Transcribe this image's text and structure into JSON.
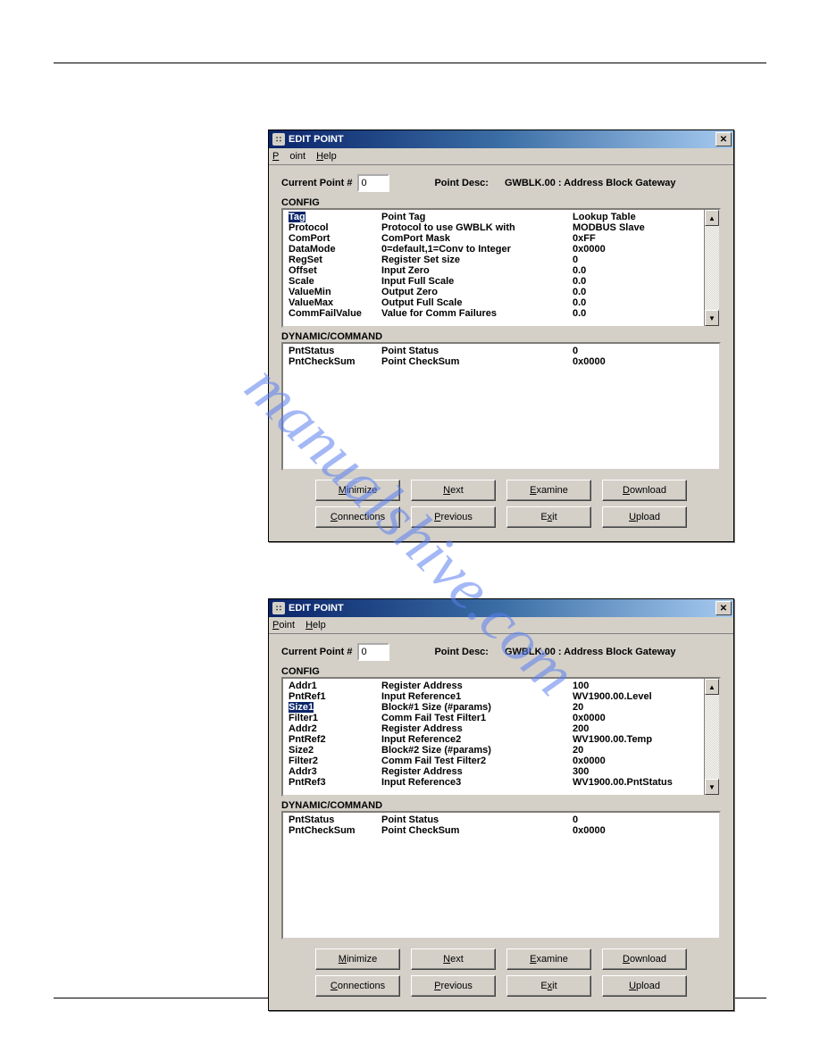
{
  "watermark": "manualshive.com",
  "windows": [
    {
      "title": "EDIT POINT",
      "menu": {
        "point": "Point",
        "help": "Help"
      },
      "current_point_label": "Current Point #",
      "current_point_value": "0",
      "point_desc_label": "Point Desc:",
      "point_desc_value": "GWBLK.00 : Address Block Gateway",
      "config_label": "CONFIG",
      "config_rows": [
        {
          "c1": "Tag",
          "c2": "Point Tag",
          "c3": "Lookup Table",
          "sel": true
        },
        {
          "c1": "Protocol",
          "c2": "Protocol to use GWBLK with",
          "c3": "MODBUS Slave"
        },
        {
          "c1": "ComPort",
          "c2": "ComPort Mask",
          "c3": "0xFF"
        },
        {
          "c1": "DataMode",
          "c2": "0=default,1=Conv to Integer",
          "c3": "0x0000"
        },
        {
          "c1": "RegSet",
          "c2": "Register Set size",
          "c3": "0"
        },
        {
          "c1": "Offset",
          "c2": "Input Zero",
          "c3": "0.0"
        },
        {
          "c1": "Scale",
          "c2": "Input Full Scale",
          "c3": "0.0"
        },
        {
          "c1": "ValueMin",
          "c2": "Output Zero",
          "c3": "0.0"
        },
        {
          "c1": "ValueMax",
          "c2": "Output Full Scale",
          "c3": "0.0"
        },
        {
          "c1": "CommFailValue",
          "c2": "Value for Comm Failures",
          "c3": "0.0"
        }
      ],
      "dynamic_label": "DYNAMIC/COMMAND",
      "dynamic_rows": [
        {
          "c1": "PntStatus",
          "c2": "Point Status",
          "c3": "0"
        },
        {
          "c1": "PntCheckSum",
          "c2": "Point CheckSum",
          "c3": "0x0000"
        }
      ],
      "buttons": {
        "minimize": "Minimize",
        "next": "Next",
        "examine": "Examine",
        "download": "Download",
        "connections": "Connections",
        "previous": "Previous",
        "exit": "Exit",
        "upload": "Upload"
      }
    },
    {
      "title": "EDIT POINT",
      "menu": {
        "point": "Point",
        "help": "Help"
      },
      "current_point_label": "Current Point #",
      "current_point_value": "0",
      "point_desc_label": "Point Desc:",
      "point_desc_value": "GWBLK.00 : Address Block Gateway",
      "config_label": "CONFIG",
      "config_rows": [
        {
          "c1": "Addr1",
          "c2": "Register Address",
          "c3": "100"
        },
        {
          "c1": "PntRef1",
          "c2": "Input Reference1",
          "c3": "WV1900.00.Level"
        },
        {
          "c1": "Size1",
          "c2": "Block#1 Size (#params)",
          "c3": "20",
          "sel": true
        },
        {
          "c1": "Filter1",
          "c2": "Comm Fail Test Filter1",
          "c3": "0x0000"
        },
        {
          "c1": "Addr2",
          "c2": "Register Address",
          "c3": "200"
        },
        {
          "c1": "PntRef2",
          "c2": "Input Reference2",
          "c3": "WV1900.00.Temp"
        },
        {
          "c1": "Size2",
          "c2": "Block#2 Size (#params)",
          "c3": "20"
        },
        {
          "c1": "Filter2",
          "c2": "Comm Fail Test Filter2",
          "c3": "0x0000"
        },
        {
          "c1": "Addr3",
          "c2": "Register Address",
          "c3": "300"
        },
        {
          "c1": "PntRef3",
          "c2": "Input Reference3",
          "c3": "WV1900.00.PntStatus"
        }
      ],
      "dynamic_label": "DYNAMIC/COMMAND",
      "dynamic_rows": [
        {
          "c1": "PntStatus",
          "c2": "Point Status",
          "c3": "0"
        },
        {
          "c1": "PntCheckSum",
          "c2": "Point CheckSum",
          "c3": "0x0000"
        }
      ],
      "buttons": {
        "minimize": "Minimize",
        "next": "Next",
        "examine": "Examine",
        "download": "Download",
        "connections": "Connections",
        "previous": "Previous",
        "exit": "Exit",
        "upload": "Upload"
      }
    }
  ]
}
